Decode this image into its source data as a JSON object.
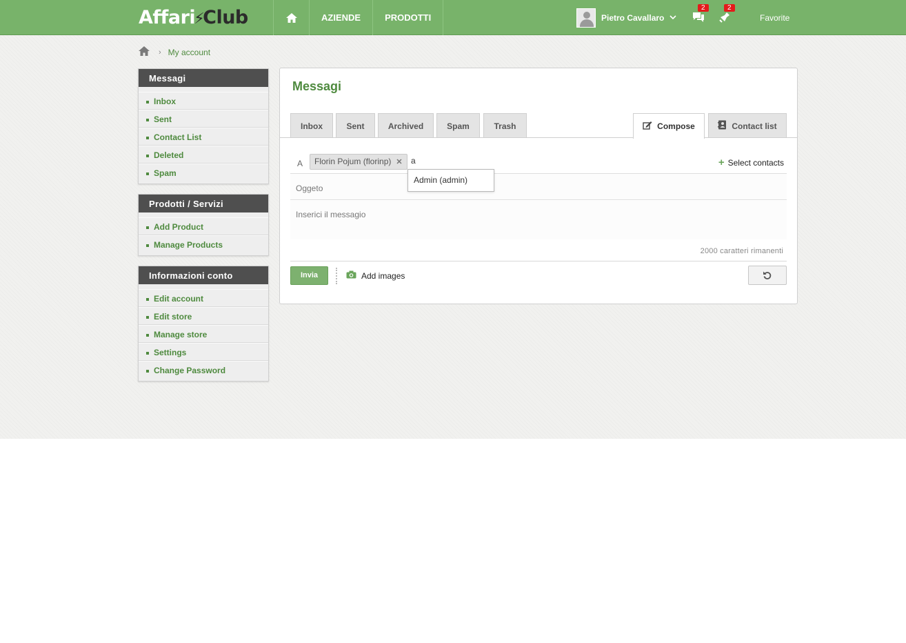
{
  "brand": {
    "logo_part1": "Affari",
    "logo_part2": "Club"
  },
  "topnav": {
    "items": [
      {
        "label": "AZIENDE"
      },
      {
        "label": "PRODOTTI"
      }
    ],
    "user_name": "Pietro Cavallaro",
    "messages_badge": "2",
    "notifications_badge": "2",
    "favorite_label": "Favorite"
  },
  "breadcrumb": {
    "current": "My account"
  },
  "sidebar": {
    "messages": {
      "title": "Messagi",
      "items": [
        "Inbox",
        "Sent",
        "Contact List",
        "Deleted",
        "Spam"
      ]
    },
    "products": {
      "title": "Prodotti / Servizi",
      "items": [
        "Add Product",
        "Manage Products"
      ]
    },
    "account": {
      "title": "Informazioni conto",
      "items": [
        "Edit account",
        "Edit store",
        "Manage store",
        "Settings",
        "Change Password"
      ]
    }
  },
  "main": {
    "title": "Messagi",
    "tabs": [
      "Inbox",
      "Sent",
      "Archived",
      "Spam",
      "Trash"
    ],
    "compose_tab": "Compose",
    "contact_list_tab": "Contact list",
    "to_label": "A",
    "recipient_chip": "Florin Pojum (florinp)",
    "to_input_value": "a",
    "autocomplete_option": "Admin (admin)",
    "select_contacts": "Select contacts",
    "subject_placeholder": "Oggeto",
    "message_placeholder": "Inserici il messagio",
    "chars_remaining": "2000 caratteri rimanenti",
    "send_button": "Invia",
    "add_images": "Add images"
  },
  "colors": {
    "brand_green": "#78b36a",
    "link_green": "#4e8a3e",
    "badge_red": "#e41b1b",
    "sidebar_header": "#4f4f4f"
  }
}
